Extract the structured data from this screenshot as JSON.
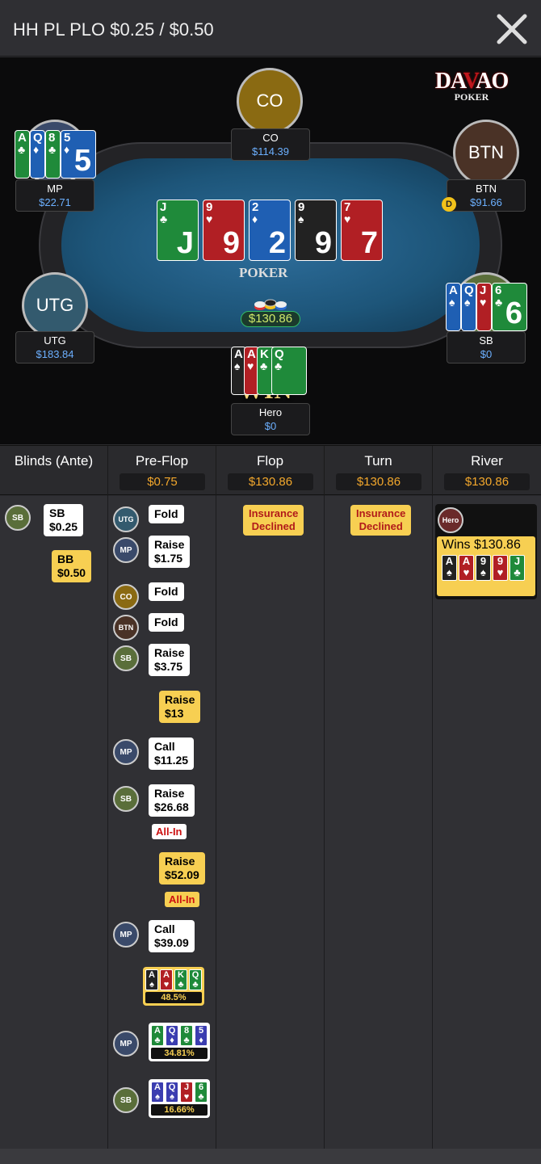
{
  "header": {
    "title": "HH PL PLO $0.25 / $0.50",
    "close_icon": "close-icon"
  },
  "logo": {
    "main": "DAVAO",
    "sub": "POKER"
  },
  "felt_logo": "POKER",
  "seats": [
    {
      "id": "co",
      "avatar": "CO",
      "name": "CO",
      "stack": "$114.39",
      "color": "#8a6a12"
    },
    {
      "id": "mp",
      "avatar": "MP",
      "name": "MP",
      "stack": "$22.71",
      "color": "#3a4a6a"
    },
    {
      "id": "btn",
      "avatar": "BTN",
      "name": "BTN",
      "stack": "$91.66",
      "color": "#4a3226"
    },
    {
      "id": "utg",
      "avatar": "UTG",
      "name": "UTG",
      "stack": "$183.84",
      "color": "#335a6e"
    },
    {
      "id": "sb",
      "avatar": "SB",
      "name": "SB",
      "stack": "$0",
      "color": "#5a6e3a"
    },
    {
      "id": "hero",
      "avatar": "Hero",
      "name": "Hero",
      "stack": "$0",
      "color": "#6a2a2a"
    }
  ],
  "dealer_button": "D",
  "board": [
    {
      "rank": "J",
      "suit": "♣",
      "color": "g"
    },
    {
      "rank": "9",
      "suit": "♥",
      "color": "r"
    },
    {
      "rank": "2",
      "suit": "♦",
      "color": "b"
    },
    {
      "rank": "9",
      "suit": "♠",
      "color": "k"
    },
    {
      "rank": "7",
      "suit": "♥",
      "color": "r"
    }
  ],
  "mp_cards": [
    {
      "rank": "A",
      "suit": "♣",
      "color": "g"
    },
    {
      "rank": "Q",
      "suit": "♦",
      "color": "b"
    },
    {
      "rank": "8",
      "suit": "♣",
      "color": "g"
    },
    {
      "rank": "5",
      "suit": "♦",
      "color": "b"
    }
  ],
  "sb_cards": [
    {
      "rank": "A",
      "suit": "♠",
      "color": "b"
    },
    {
      "rank": "Q",
      "suit": "♠",
      "color": "b"
    },
    {
      "rank": "J",
      "suit": "♥",
      "color": "r"
    },
    {
      "rank": "6",
      "suit": "♣",
      "color": "g"
    }
  ],
  "hero_cards": [
    {
      "rank": "A",
      "suit": "♠",
      "color": "k"
    },
    {
      "rank": "A",
      "suit": "♥",
      "color": "r"
    },
    {
      "rank": "K",
      "suit": "♣",
      "color": "g"
    },
    {
      "rank": "Q",
      "suit": "♣",
      "color": "g"
    }
  ],
  "pot": "$130.86",
  "win_label": "WIN",
  "streets": [
    {
      "name": "Blinds (Ante)",
      "pot": ""
    },
    {
      "name": "Pre-Flop",
      "pot": "$0.75"
    },
    {
      "name": "Flop",
      "pot": "$130.86"
    },
    {
      "name": "Turn",
      "pot": "$130.86"
    },
    {
      "name": "River",
      "pot": "$130.86"
    }
  ],
  "blinds": {
    "sb_pill": "SB",
    "sb_label": "SB",
    "sb_amount": "$0.25",
    "bb_label": "BB",
    "bb_amount": "$0.50"
  },
  "preflop": [
    {
      "pill": "UTG",
      "action": "Fold",
      "amount": ""
    },
    {
      "pill": "MP",
      "action": "Raise",
      "amount": "$1.75"
    },
    {
      "pill": "CO",
      "action": "Fold",
      "amount": ""
    },
    {
      "pill": "BTN",
      "action": "Fold",
      "amount": ""
    },
    {
      "pill": "SB",
      "action": "Raise",
      "amount": "$3.75"
    },
    {
      "pill": "",
      "action": "Raise",
      "amount": "$13"
    },
    {
      "pill": "MP",
      "action": "Call",
      "amount": "$11.25"
    },
    {
      "pill": "SB",
      "action": "Raise",
      "amount": "$26.68",
      "allin": "All-In"
    },
    {
      "pill": "",
      "action": "Raise",
      "amount": "$52.09",
      "allin": "All-In"
    },
    {
      "pill": "MP",
      "action": "Call",
      "amount": "$39.09"
    }
  ],
  "equities": [
    {
      "pill": "",
      "cards": [
        {
          "r": "A",
          "s": "♠",
          "c": "k"
        },
        {
          "r": "A",
          "s": "♥",
          "c": "r"
        },
        {
          "r": "K",
          "s": "♣",
          "c": "g"
        },
        {
          "r": "Q",
          "s": "♣",
          "c": "g"
        }
      ],
      "pct": "48.5%"
    },
    {
      "pill": "MP",
      "cards": [
        {
          "r": "A",
          "s": "♣",
          "c": "g"
        },
        {
          "r": "Q",
          "s": "♦",
          "c": "p"
        },
        {
          "r": "8",
          "s": "♣",
          "c": "g"
        },
        {
          "r": "5",
          "s": "♦",
          "c": "p"
        }
      ],
      "pct": "34.81%"
    },
    {
      "pill": "SB",
      "cards": [
        {
          "r": "A",
          "s": "♠",
          "c": "p"
        },
        {
          "r": "Q",
          "s": "♠",
          "c": "p"
        },
        {
          "r": "J",
          "s": "♥",
          "c": "r"
        },
        {
          "r": "6",
          "s": "♣",
          "c": "g"
        }
      ],
      "pct": "16.66%"
    }
  ],
  "flop": {
    "line1": "Insurance",
    "line2": "Declined"
  },
  "turn": {
    "line1": "Insurance",
    "line2": "Declined"
  },
  "river": {
    "pill": "Hero",
    "wins": "Wins $130.86",
    "cards": [
      {
        "r": "A",
        "s": "♠",
        "c": "k"
      },
      {
        "r": "A",
        "s": "♥",
        "c": "r"
      },
      {
        "r": "9",
        "s": "♠",
        "c": "k"
      },
      {
        "r": "9",
        "s": "♥",
        "c": "r"
      },
      {
        "r": "J",
        "s": "♣",
        "c": "g"
      }
    ]
  }
}
